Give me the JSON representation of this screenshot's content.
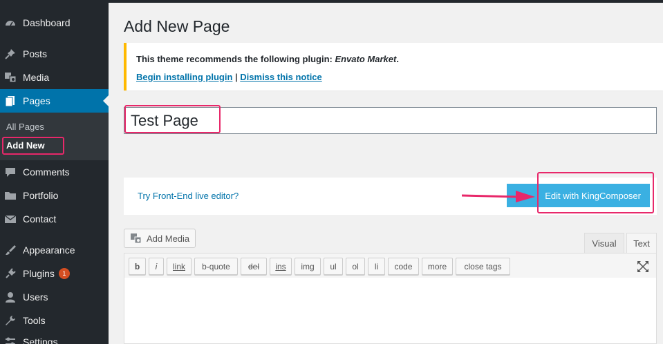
{
  "sidebar": {
    "items": [
      {
        "id": "dashboard",
        "label": "Dashboard",
        "icon": "dashboard-icon"
      },
      {
        "id": "posts",
        "label": "Posts",
        "icon": "pushpin-icon"
      },
      {
        "id": "media",
        "label": "Media",
        "icon": "media-icon"
      },
      {
        "id": "pages",
        "label": "Pages",
        "icon": "pages-icon"
      },
      {
        "id": "comments",
        "label": "Comments",
        "icon": "comment-icon"
      },
      {
        "id": "portfolio",
        "label": "Portfolio",
        "icon": "folder-icon"
      },
      {
        "id": "contact",
        "label": "Contact",
        "icon": "mail-icon"
      },
      {
        "id": "appearance",
        "label": "Appearance",
        "icon": "paintbrush-icon"
      },
      {
        "id": "plugins",
        "label": "Plugins",
        "icon": "plugin-icon",
        "badge": "1"
      },
      {
        "id": "users",
        "label": "Users",
        "icon": "user-icon"
      },
      {
        "id": "tools",
        "label": "Tools",
        "icon": "wrench-icon"
      },
      {
        "id": "settings",
        "label": "Settings",
        "icon": "settings-icon"
      }
    ],
    "submenu": [
      {
        "label": "All Pages"
      },
      {
        "label": "Add New",
        "current": true
      }
    ]
  },
  "main": {
    "title": "Add New Page",
    "notice": {
      "text": "This theme recommends the following plugin: ",
      "plugin": "Envato Market",
      "period": ".",
      "link1": "Begin installing plugin",
      "separator": "|",
      "link2": "Dismiss this notice"
    },
    "title_input": {
      "value": "Test Page"
    },
    "kingcomposer": {
      "link": "Try Front-End live editor?",
      "button": "Edit with KingComposer"
    },
    "add_media": "Add Media",
    "tabs": [
      {
        "label": "Visual"
      },
      {
        "label": "Text"
      }
    ],
    "quicktags": [
      "b",
      "i",
      "link",
      "b-quote",
      "del",
      "ins",
      "img",
      "ul",
      "ol",
      "li",
      "code",
      "more",
      "close tags"
    ]
  },
  "colors": {
    "sidebar_bg": "#23282d",
    "active_bg": "#0073aa",
    "notice_border": "#ffb900",
    "kc_button": "#3ab0e2",
    "highlight": "#e8286a",
    "badge": "#d54e21"
  }
}
